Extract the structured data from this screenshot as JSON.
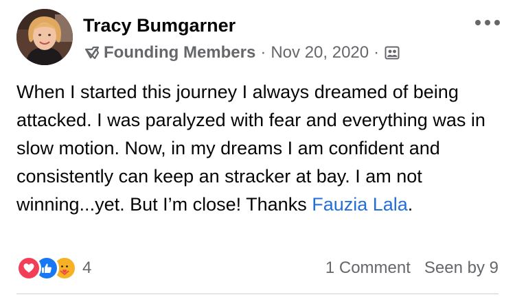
{
  "post": {
    "author": {
      "name": "Tracy Bumgarner"
    },
    "group": {
      "badge_icon": "badge-check-icon",
      "name": "Founding Members"
    },
    "separator": "·",
    "date": "Nov 20, 2020",
    "audience_icon": "members-group-icon",
    "more_icon": "more-horizontal-icon",
    "text_before_mention": "When I started this journey I always dreamed of being attacked. I was paralyzed with fear and everything was in slow motion. Now, in my dreams I am confident and consistently can keep an stracker at bay. I am not winning...yet. But I’m close! Thanks ",
    "mention": "Fauzia Lala",
    "text_after_mention": ".",
    "reactions": {
      "types": [
        "love",
        "like",
        "care"
      ],
      "count": "4"
    },
    "comments_label": "1 Comment",
    "seen_label": "Seen by 9"
  },
  "colors": {
    "text_primary": "#050505",
    "text_secondary": "#65676b",
    "link": "#216fdb",
    "love": "#f33e58",
    "like": "#1877f2",
    "care": "#f7b125",
    "divider": "#ced0d4"
  }
}
